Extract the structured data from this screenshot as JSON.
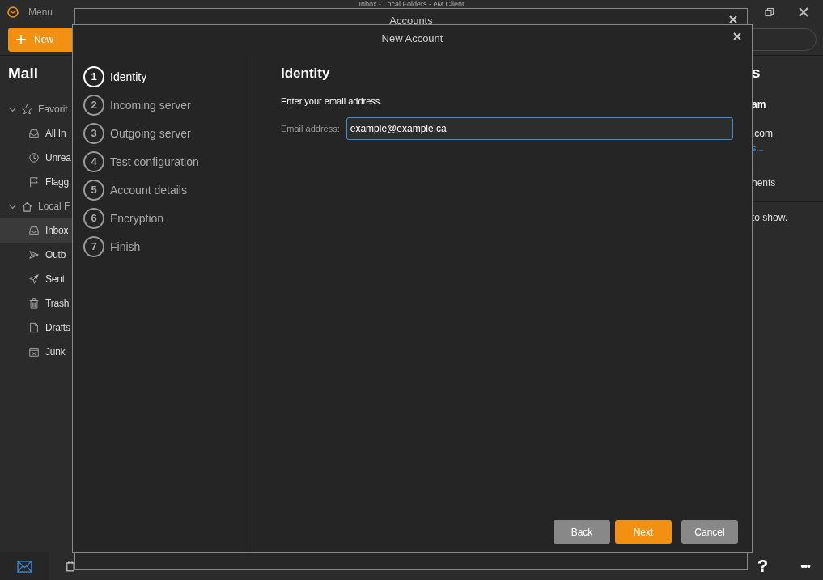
{
  "app": {
    "menu": "Menu",
    "title": "Inbox - Local Folders - eM Client",
    "new_button": "New"
  },
  "sidebar": {
    "heading": "Mail",
    "groups": [
      {
        "label": "Favorit",
        "expanded": true,
        "children": [
          {
            "label": "All In",
            "selected": false
          },
          {
            "label": "Unrea",
            "selected": false
          },
          {
            "label": "Flagg",
            "selected": false
          }
        ]
      },
      {
        "label": "Local F",
        "expanded": true,
        "children": [
          {
            "label": "Inbox",
            "selected": true
          },
          {
            "label": "Outb",
            "selected": false
          },
          {
            "label": "Sent",
            "selected": false
          },
          {
            "label": "Trash",
            "selected": false
          },
          {
            "label": "Drafts",
            "selected": false
          },
          {
            "label": "Junk",
            "selected": false
          }
        ]
      }
    ]
  },
  "right_panel": {
    "heading": "s",
    "name": "am",
    "email": ".com",
    "link": "s...",
    "section": "nents",
    "empty": "to show."
  },
  "accounts_dialog": {
    "title": "Accounts"
  },
  "new_account_dialog": {
    "title": "New Account",
    "steps": [
      {
        "number": "1",
        "label": "Identity",
        "selected": true
      },
      {
        "number": "2",
        "label": "Incoming server",
        "selected": false
      },
      {
        "number": "3",
        "label": "Outgoing server",
        "selected": false
      },
      {
        "number": "4",
        "label": "Test configuration",
        "selected": false
      },
      {
        "number": "5",
        "label": "Account details",
        "selected": false
      },
      {
        "number": "6",
        "label": "Encryption",
        "selected": false
      },
      {
        "number": "7",
        "label": "Finish",
        "selected": false
      }
    ],
    "heading": "Identity",
    "instruction": "Enter your email address.",
    "email_label": "Email address:",
    "email_value": "example@example.ca",
    "buttons": [
      {
        "label": "Back",
        "kind": "secondary"
      },
      {
        "label": "Next",
        "kind": "primary"
      },
      {
        "label": "Cancel",
        "kind": "secondary"
      }
    ]
  },
  "bottom_bar": {
    "help": "?",
    "more": "•••"
  }
}
